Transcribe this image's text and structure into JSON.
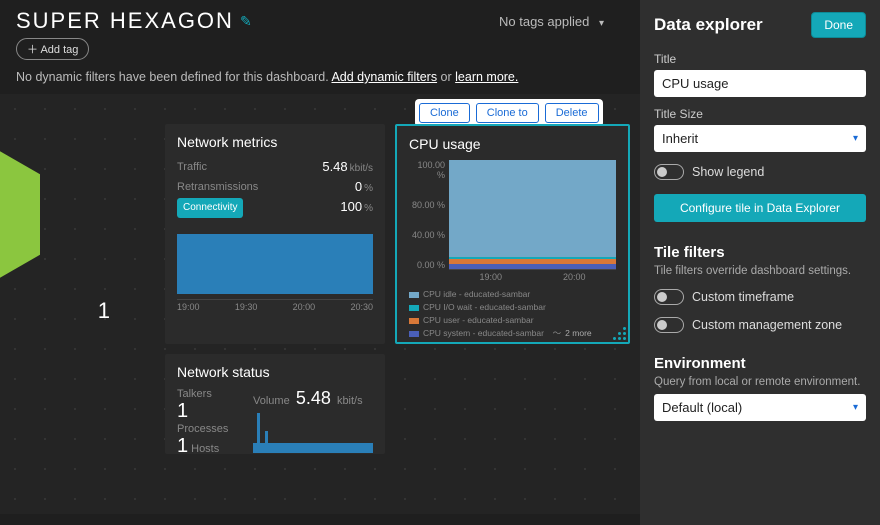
{
  "header": {
    "brand": "SUPER HEXAGON",
    "tags_label": "No tags applied",
    "add_tag": "Add tag"
  },
  "filters": {
    "prefix": "No dynamic filters have been defined for this dashboard. ",
    "add_link": "Add dynamic filters",
    "sep": " or ",
    "learn_link": "learn more."
  },
  "hex_tile": {
    "count": "1"
  },
  "network_metrics": {
    "title": "Network metrics",
    "rows": [
      {
        "label": "Traffic",
        "value": "5.48",
        "unit": "kbit/s"
      },
      {
        "label": "Retransmissions",
        "value": "0",
        "unit": "%"
      },
      {
        "label": "Connectivity",
        "value": "100",
        "unit": "%",
        "chip": true
      }
    ],
    "xaxis": [
      "19:00",
      "19:30",
      "20:00",
      "20:30"
    ]
  },
  "cpu_tile": {
    "title": "CPU usage",
    "actions": {
      "clone": "Clone",
      "clone_to": "Clone to",
      "delete": "Delete"
    },
    "legend": [
      {
        "label": "CPU idle - educated-sambar",
        "color": "#73a8c8"
      },
      {
        "label": "CPU I/O wait - educated-sambar",
        "color": "#14a8b8"
      },
      {
        "label": "CPU user - educated-sambar",
        "color": "#d87838"
      },
      {
        "label": "CPU system - educated-sambar",
        "color": "#4a5fb8"
      }
    ],
    "more": "2 more"
  },
  "chart_data": {
    "type": "area",
    "title": "CPU usage",
    "ylabel": "%",
    "ylim": [
      0,
      100
    ],
    "yticks": [
      "100.00 %",
      "80.00 %",
      "40.00 %",
      "0.00 %"
    ],
    "x": [
      "19:00",
      "20:00"
    ],
    "series": [
      {
        "name": "CPU idle - educated-sambar",
        "values": [
          89,
          90,
          88,
          90,
          89,
          90,
          88,
          90
        ]
      },
      {
        "name": "CPU I/O wait - educated-sambar",
        "values": [
          2,
          2,
          3,
          2,
          2,
          2,
          3,
          2
        ]
      },
      {
        "name": "CPU user - educated-sambar",
        "values": [
          4,
          4,
          5,
          4,
          4,
          4,
          5,
          4
        ]
      },
      {
        "name": "CPU system - educated-sambar",
        "values": [
          5,
          4,
          4,
          4,
          5,
          4,
          4,
          4
        ]
      }
    ]
  },
  "network_status": {
    "title": "Network status",
    "talkers_label": "Talkers",
    "processes": {
      "count": "1",
      "label": "Processes"
    },
    "hosts": {
      "count": "1",
      "label": "Hosts"
    },
    "volume_label": "Volume",
    "volume_value": "5.48",
    "volume_unit": "kbit/s"
  },
  "panel": {
    "title": "Data explorer",
    "done": "Done",
    "title_field": {
      "label": "Title",
      "value": "CPU usage"
    },
    "title_size": {
      "label": "Title Size",
      "value": "Inherit"
    },
    "show_legend": "Show legend",
    "config_btn": "Configure tile in Data Explorer",
    "tile_filters": {
      "heading": "Tile filters",
      "sub": "Tile filters override dashboard settings."
    },
    "custom_timeframe": "Custom timeframe",
    "custom_mz": "Custom management zone",
    "environment": {
      "heading": "Environment",
      "sub": "Query from local or remote environment.",
      "value": "Default (local)"
    }
  }
}
